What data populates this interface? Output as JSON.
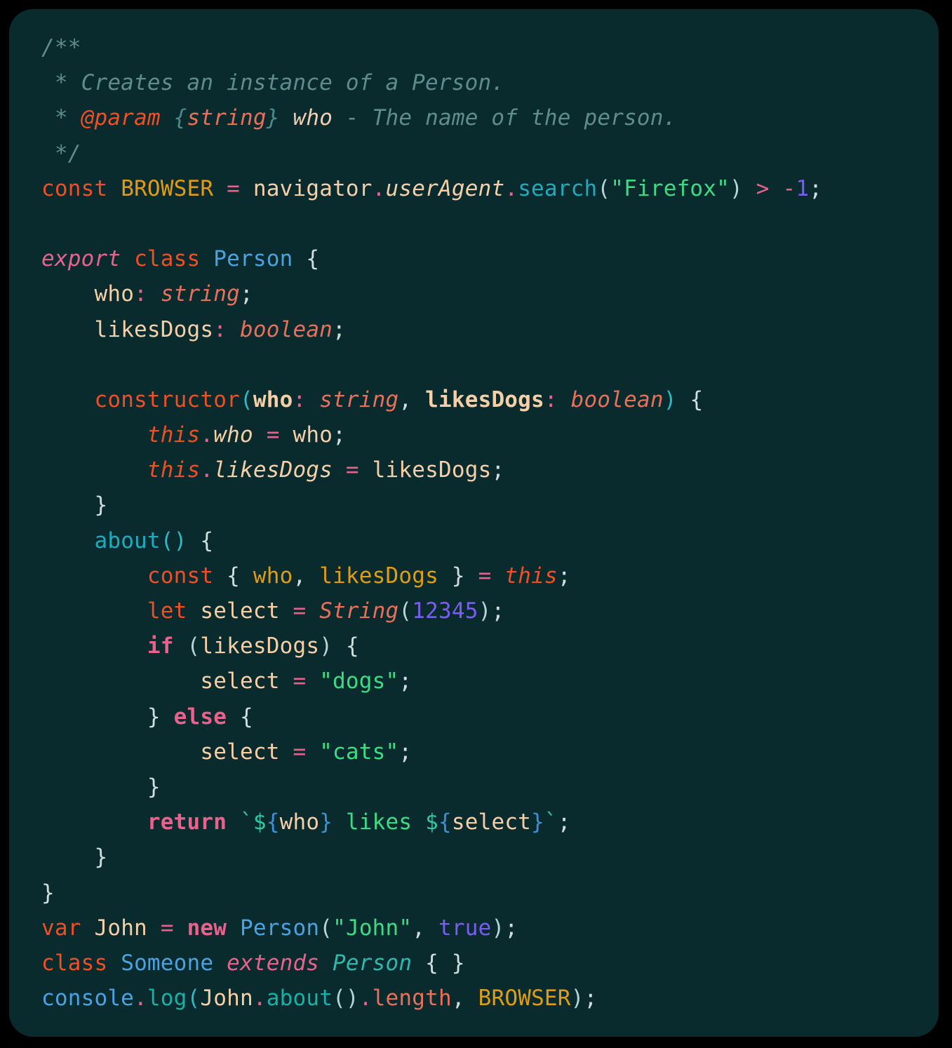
{
  "card": {
    "background": "#0a2b2e",
    "page_background": "#000000",
    "corner_radius_px": 34
  },
  "palette": {
    "default_text": "#f2cdb0",
    "comment": "#5f8c8c",
    "keyword_orange": "#f04e23",
    "keyword_pink": "#e8628c",
    "string_green": "#3ddc84",
    "number_purple": "#7b5cf0",
    "class_blue": "#4aa3e0",
    "function_cyan": "#1cabbf",
    "type_salmon": "#e8705a",
    "amber": "#e09c12",
    "punctuation": "#cfdede"
  },
  "code": {
    "language": "typescript",
    "line_count": 27,
    "lines": [
      "/**",
      " * Creates an instance of a Person.",
      " * @param {string} who - The name of the person.",
      " */",
      "const BROWSER = navigator.userAgent.search(\"Firefox\") > -1;",
      "",
      "export class Person {",
      "    who: string;",
      "    likesDogs: boolean;",
      "",
      "    constructor(who: string, likesDogs: boolean) {",
      "        this.who = who;",
      "        this.likesDogs = likesDogs;",
      "    }",
      "    about() {",
      "        const { who, likesDogs } = this;",
      "        let select = String(12345);",
      "        if (likesDogs) {",
      "            select = \"dogs\";",
      "        } else {",
      "            select = \"cats\";",
      "        }",
      "        return `${who} likes ${select}`;",
      "    }",
      "}",
      "var John = new Person(\"John\", true);",
      "class Someone extends Person { }",
      "console.log(John.about().length, BROWSER);"
    ],
    "identifiers": {
      "constant": "BROWSER",
      "class_name": "Person",
      "subclass_name": "Someone",
      "instance_name": "John",
      "method_name": "about",
      "constructor_params": [
        "who",
        "likesDogs"
      ],
      "local_variable": "select",
      "browser_check_string": "Firefox",
      "numeric_literal": "12345",
      "string_dogs": "dogs",
      "string_cats": "cats",
      "boolean_literal": "true",
      "comparison": "> -1"
    },
    "jsdoc": {
      "summary": "Creates an instance of a Person.",
      "tag": "@param",
      "param_type": "{string}",
      "param_name": "who",
      "param_description": "- The name of the person."
    }
  }
}
